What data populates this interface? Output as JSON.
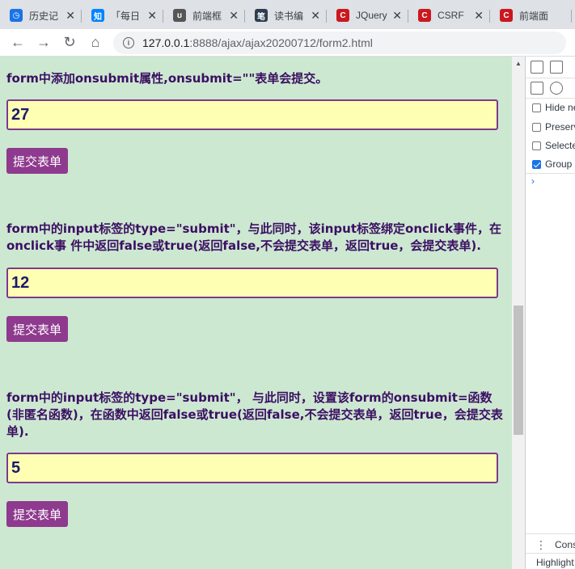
{
  "tabs": [
    {
      "title": "历史记",
      "fav": "◷",
      "fav_color": "#1a73e8"
    },
    {
      "title": "「每日",
      "fav": "知",
      "fav_color": "#0084ff"
    },
    {
      "title": "前端框",
      "fav": "ʊ",
      "fav_color": "#555555"
    },
    {
      "title": "读书编",
      "fav": "笔",
      "fav_color": "#2c3e50"
    },
    {
      "title": "JQuery",
      "fav": "C",
      "fav_color": "#c9181e"
    },
    {
      "title": "CSRF",
      "fav": "C",
      "fav_color": "#c9181e"
    },
    {
      "title": "前端面",
      "fav": "C",
      "fav_color": "#c9181e"
    }
  ],
  "toolbar": {
    "url_host": "127.0.0.1",
    "url_path": ":8888/ajax/ajax20200712/form2.html"
  },
  "page": {
    "sections": [
      {
        "desc": "form中添加onsubmit属性,onsubmit=\"\"表单会提交。",
        "value": "27",
        "button": "提交表单"
      },
      {
        "desc": "form中的input标签的type=\"submit\"，与此同时，该input标签绑定onclick事件，在onclick事 件中返回false或true(返回false,不会提交表单，返回true，会提交表单).",
        "value": "12",
        "button": "提交表单"
      },
      {
        "desc": "form中的input标签的type=\"submit\"， 与此同时，设置该form的onsubmit=函数(非匿名函数)，在函数中返回false或true(返回false,不会提交表单，返回true，会提交表单).",
        "value": "5",
        "button": "提交表单"
      }
    ]
  },
  "devtools": {
    "options": [
      {
        "label": "Hide ne",
        "checked": false
      },
      {
        "label": "Preserv",
        "checked": false
      },
      {
        "label": "Selecte",
        "checked": false
      },
      {
        "label": "Group s",
        "checked": true
      }
    ],
    "prompt": "›",
    "drawer_tab": "Conso",
    "bottom_label": "Highlight"
  }
}
